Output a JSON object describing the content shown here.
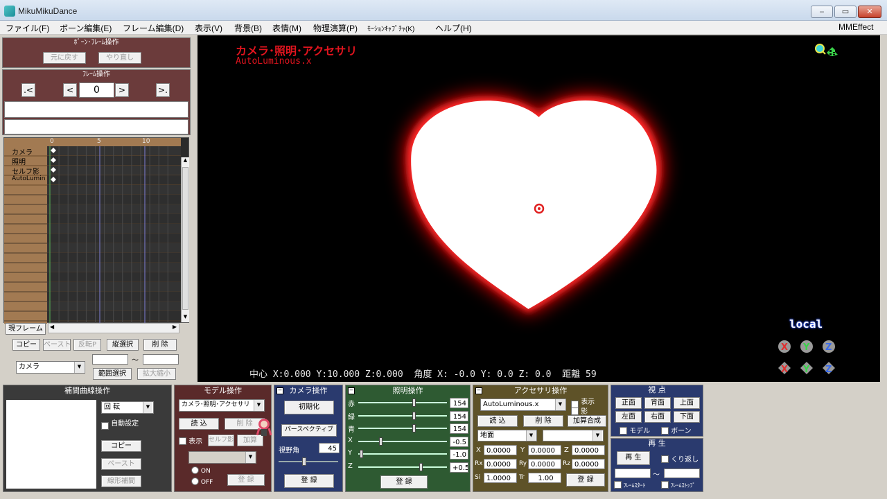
{
  "window": {
    "title": "MikuMikuDance"
  },
  "menu": [
    "ファイル(F)",
    "ボーン編集(E)",
    "フレーム編集(D)",
    "表示(V)",
    "背景(B)",
    "表情(M)",
    "物理演算(P)",
    "ﾓｰｼｮﾝｷｬﾌﾟﾁｬ(K)",
    "ヘルプ(H)",
    "MMEffect"
  ],
  "bone_frame": {
    "title": "ﾎﾞｰﾝ･ﾌﾚｰﾑ操作",
    "undo": "元に戻す",
    "redo": "やり直し"
  },
  "frame_ops": {
    "title": "ﾌﾚｰﾑ操作",
    "first": ".<",
    "prev": "<",
    "frame_value": "0",
    "next": ">",
    "last": ">."
  },
  "timeline": {
    "ruler": [
      "0",
      "5",
      "10"
    ],
    "tracks": [
      "カメラ",
      "照明",
      "セルフ影",
      "AutoLumin"
    ],
    "current_frame_label": "現フレーム"
  },
  "edit_buttons": {
    "copy": "コピー",
    "paste": "ペースト",
    "invert": "反転P",
    "vselect": "縦選択",
    "delete": "削 除",
    "range_select": "範囲選択",
    "scale": "拡大縮小",
    "tilde": "～"
  },
  "left_dropdown": {
    "value": "カメラ"
  },
  "interp": {
    "title": "補間曲線操作",
    "select_value": "回 転",
    "auto_label": "自動設定",
    "copy": "コピー",
    "paste": "ペースト",
    "linear": "線形補間"
  },
  "model_ops": {
    "title": "モデル操作",
    "select_value": "カメラ･照明･アクセサリ",
    "load": "読 込",
    "delete": "削 除",
    "show": "表示",
    "self_shadow": "セルフ影",
    "add": "加算",
    "on": "ON",
    "off": "OFF",
    "register": "登 録"
  },
  "camera_ops": {
    "title": "カメラ操作",
    "reset": "初期化",
    "perspective": "パースペクティブ",
    "fov_label": "視野角",
    "fov_value": "45",
    "register": "登 録"
  },
  "light_ops": {
    "title": "照明操作",
    "rows": [
      {
        "label": "赤",
        "value": "154"
      },
      {
        "label": "緑",
        "value": "154"
      },
      {
        "label": "青",
        "value": "154"
      },
      {
        "label": "X",
        "value": "-0.5"
      },
      {
        "label": "Y",
        "value": "-1.0"
      },
      {
        "label": "Z",
        "value": "+0.5"
      }
    ],
    "register": "登 録"
  },
  "accessory_ops": {
    "title": "アクセサリ操作",
    "select_value": "AutoLuminous.x",
    "show": "表示",
    "shadow": "影",
    "load": "読 込",
    "delete": "削 除",
    "add_blend": "加算合成",
    "attach_value": "地面",
    "attach2_value": "",
    "x_label": "X",
    "x": "0.0000",
    "y_label": "Y",
    "y": "0.0000",
    "z_label": "Z",
    "z": "0.0000",
    "rx_label": "Rx",
    "rx": "0.0000",
    "ry_label": "Ry",
    "ry": "0.0000",
    "rz_label": "Rz",
    "rz": "0.0000",
    "si_label": "Si",
    "si": "1.0000",
    "tr_label": "Tr",
    "tr": "1.00",
    "register": "登 録"
  },
  "viewpoint": {
    "title": "視 点",
    "front": "正面",
    "back": "背面",
    "top": "上面",
    "left": "左面",
    "right": "右面",
    "bottom": "下面",
    "model": "モデル",
    "bone": "ボーン"
  },
  "playback": {
    "title": "再 生",
    "play": "再 生",
    "loop": "くり返し",
    "start": "ﾌﾚｰﾑｽﾀｰﾄ",
    "stop": "ﾌﾚｰﾑｽﾄｯﾌﾟ",
    "tilde": "～"
  },
  "viewport": {
    "title": "カメラ･照明･アクセサリ",
    "model_file": "AutoLuminous.x",
    "status": "中心 X:0.000 Y:10.000 Z:0.000  角度 X: -0.0 Y: 0.0 Z: 0.0  距離 59",
    "mode": "local"
  },
  "colors": {
    "viewport_bg": "#000000",
    "heart_glow": "#ff1010",
    "label_red": "#e0141e",
    "panel_maroon": "#5a2a2a",
    "panel_navy": "#2a3a6e",
    "panel_green": "#2e5a32",
    "panel_olive": "#5e5228"
  }
}
